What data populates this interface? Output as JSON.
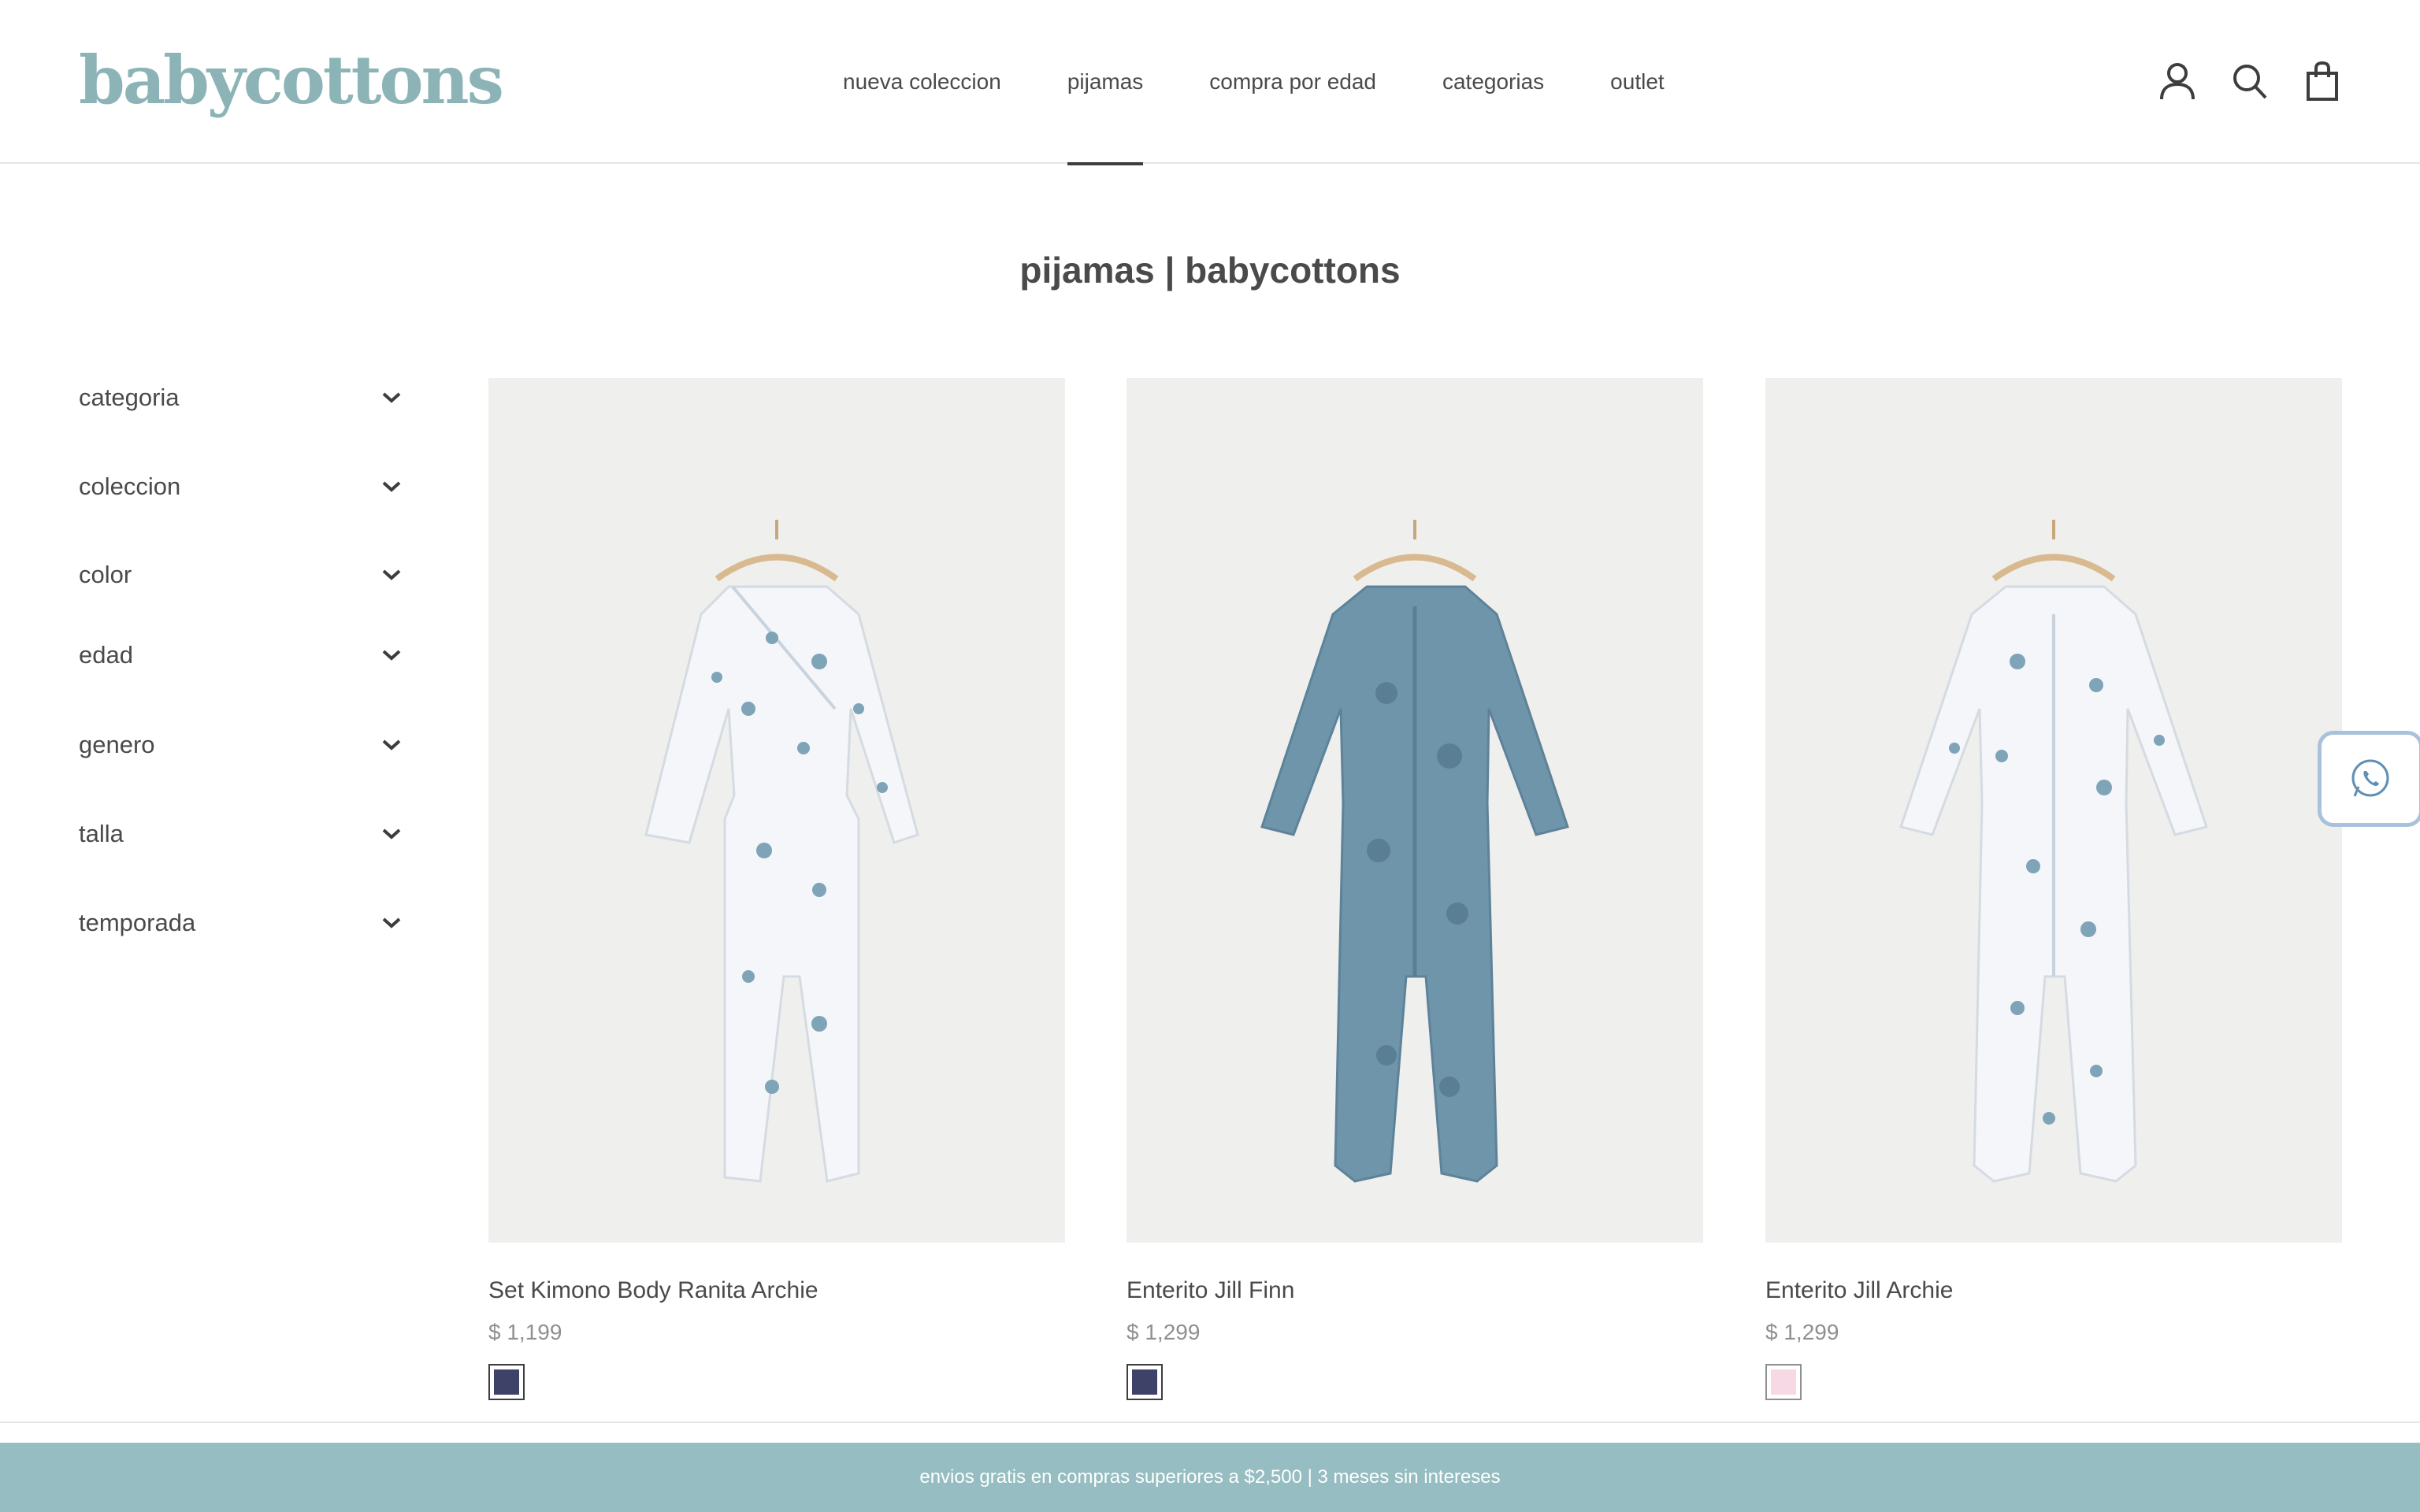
{
  "header": {
    "logo": "babycottons",
    "nav": [
      {
        "label": "nueva coleccion",
        "active": false
      },
      {
        "label": "pijamas",
        "active": true
      },
      {
        "label": "compra por edad",
        "active": false
      },
      {
        "label": "categorias",
        "active": false
      },
      {
        "label": "outlet",
        "active": false
      }
    ],
    "icons": [
      "account-icon",
      "search-icon",
      "cart-icon"
    ]
  },
  "page": {
    "title": "pijamas | babycottons"
  },
  "filters": [
    {
      "label": "categoria"
    },
    {
      "label": "coleccion"
    },
    {
      "label": "color"
    },
    {
      "label": "edad"
    },
    {
      "label": "genero"
    },
    {
      "label": "talla"
    },
    {
      "label": "temporada"
    }
  ],
  "products": [
    {
      "name": "Set Kimono Body Ranita Archie",
      "price": "$ 1,199",
      "swatch_color": "#3f4268",
      "garment_color": "#f4f6f9",
      "print_color": "#7fa3b7"
    },
    {
      "name": "Enterito Jill Finn",
      "price": "$ 1,299",
      "swatch_color": "#3f4268",
      "garment_color": "#6f95ab",
      "print_color": "#5a7f95"
    },
    {
      "name": "Enterito Jill Archie",
      "price": "$ 1,299",
      "swatch_color": "#f7d9e6",
      "garment_color": "#f4f6f9",
      "print_color": "#7fa3b7"
    }
  ],
  "whatsapp": {
    "icon": "whatsapp-icon"
  },
  "promo": {
    "text": "envios gratis en compras superiores a $2,500 | 3 meses sin intereses"
  },
  "colors": {
    "brand": "#8cb3b6",
    "promo_bar": "#96bdc1",
    "whatsapp_border": "#a9c2dc"
  }
}
